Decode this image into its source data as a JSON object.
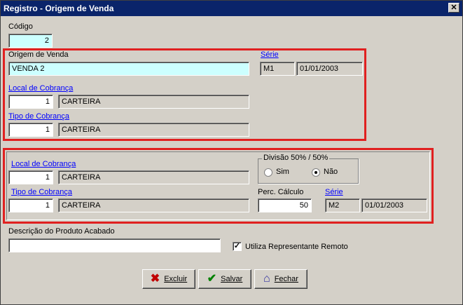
{
  "window": {
    "title": "Registro - Origem de Venda",
    "close_glyph": "✕"
  },
  "codigo": {
    "label": "Código",
    "value": "2"
  },
  "origem": {
    "label": "Origem de Venda",
    "value": "VENDA 2",
    "serie_label": "Série",
    "serie_value": "M1",
    "serie_date": "01/01/2003",
    "local_label": "Local de Cobrança",
    "local_code": "1",
    "local_name": "CARTEIRA",
    "tipo_label": "Tipo de Cobrança",
    "tipo_code": "1",
    "tipo_name": "CARTEIRA"
  },
  "second": {
    "local_label": "Local de Cobrança",
    "local_code": "1",
    "local_name": "CARTEIRA",
    "tipo_label": "Tipo de Cobrança",
    "tipo_code": "1",
    "tipo_name": "CARTEIRA",
    "divisao_title": "Divisão 50% / 50%",
    "sim_label": "Sim",
    "nao_label": "Não",
    "selected": "Não",
    "perc_label": "Perc. Cálculo",
    "perc_value": "50",
    "serie_label": "Série",
    "serie_value": "M2",
    "serie_date": "01/01/2003"
  },
  "descricao": {
    "label": "Descrição do Produto Acabado",
    "value": ""
  },
  "remoto": {
    "label": "Utiliza Representante Remoto",
    "checked": true,
    "check_glyph": "✓"
  },
  "buttons": {
    "excluir": {
      "label": "Excluir",
      "icon": "x-icon",
      "glyph": "✖",
      "color": "#c00000"
    },
    "salvar": {
      "label": "Salvar",
      "icon": "checkmark-icon",
      "glyph": "✔",
      "color": "#008000"
    },
    "fechar": {
      "label": "Fechar",
      "icon": "door-icon",
      "glyph": "⌂",
      "color": "#3030a0"
    }
  },
  "accent": {
    "highlight": "#e02020",
    "titlebar": "#0a246a"
  }
}
